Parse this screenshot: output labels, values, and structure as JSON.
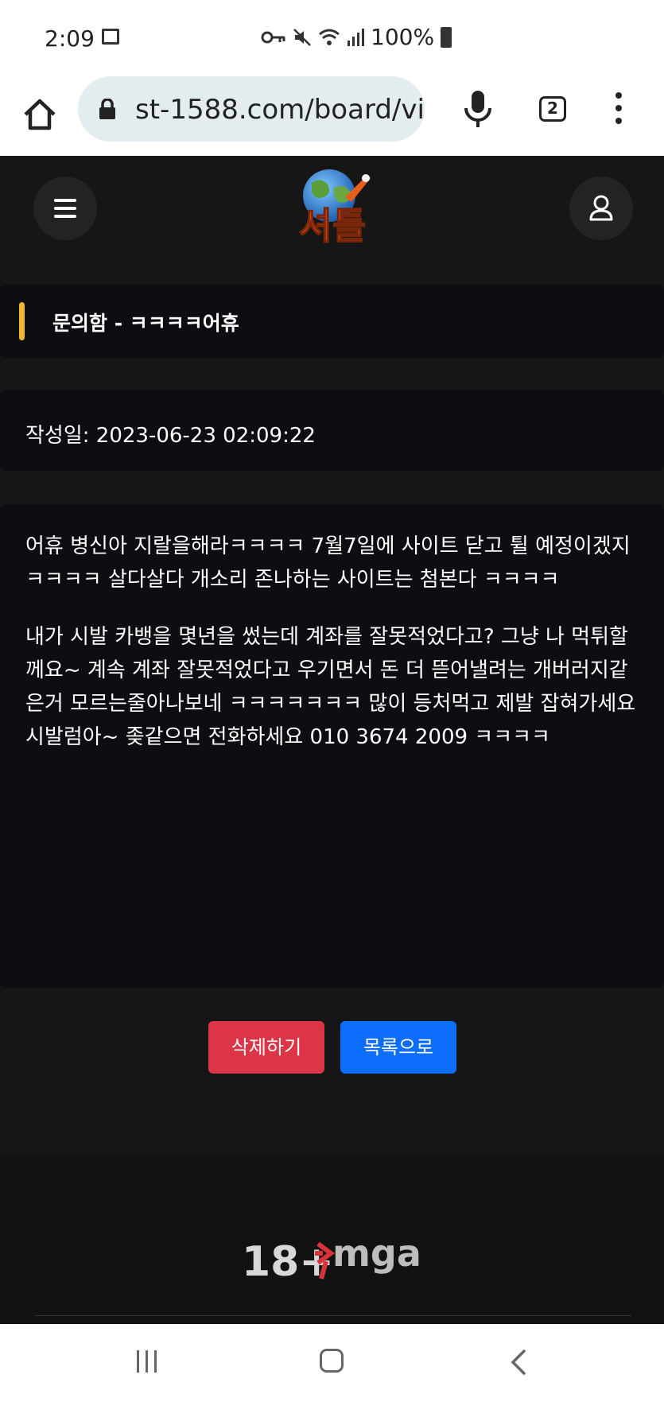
{
  "status_bar": {
    "time": "2:09",
    "battery": "100%",
    "icons": [
      "gallery-icon",
      "key-icon",
      "mute-icon",
      "wifi-icon",
      "signal-icon",
      "battery-icon"
    ]
  },
  "browser": {
    "url": "st-1588.com/board/vi",
    "tab_count": "2"
  },
  "header": {
    "logo_text": "셔틀"
  },
  "post": {
    "title": "문의함 - ㅋㅋㅋㅋ어휴",
    "date": "작성일: 2023-06-23 02:09:22",
    "paragraphs": [
      "어휴 병신아 지랄을해라ㅋㅋㅋㅋ 7월7일에 사이트 닫고 튈 예정이겠지ㅋㅋㅋㅋ 살다살다 개소리 존나하는 사이트는 첨본다 ㅋㅋㅋㅋ",
      "내가 시발 카뱅을 몇년을 썼는데 계좌를 잘못적었다고? 그냥 나 먹튀할께요~ 계속 계좌 잘못적었다고 우기면서 돈 더 뜯어낼려는 개버러지같은거 모르는줄아나보네 ㅋㅋㅋㅋㅋㅋㅋ 많이 등처먹고 제발 잡혀가세요 시발럼아~ 좆같으면 전화하세요 010 3674 2009 ㅋㅋㅋㅋ"
    ]
  },
  "actions": {
    "delete_label": "삭제하기",
    "list_label": "목록으로"
  },
  "footer": {
    "age_badge": "18+",
    "mga_label": "mga"
  },
  "colors": {
    "accent": "#f0b832",
    "delete": "#dc3545",
    "list": "#0d6efd"
  }
}
